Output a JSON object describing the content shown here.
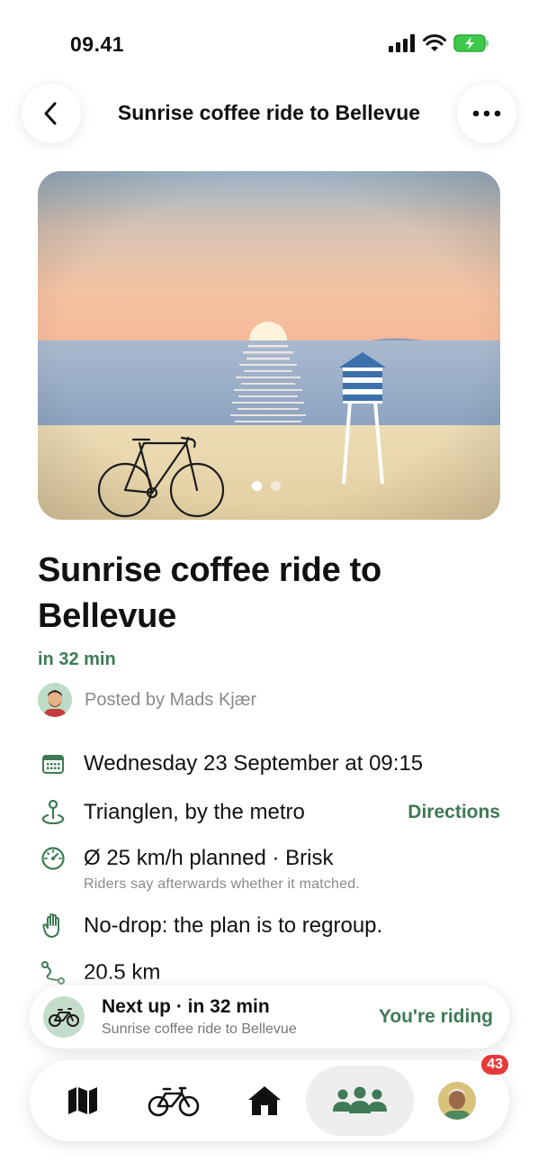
{
  "status_bar": {
    "time": "09.41"
  },
  "header": {
    "title": "Sunrise coffee ride to Bellevue"
  },
  "ride": {
    "title": "Sunrise coffee ride to Bellevue",
    "starts_in": "in 32 min",
    "posted_by": "Posted by Mads Kjær",
    "carousel": {
      "pages": 2,
      "current": 1
    },
    "details": [
      {
        "icon": "calendar-icon",
        "text": "Wednesday 23 September at 09:15"
      },
      {
        "icon": "meeting-point-icon",
        "text": "Trianglen, by the metro",
        "action": "Directions"
      },
      {
        "icon": "speedometer-icon",
        "text": "Ø 25 km/h planned · Brisk",
        "sub": "Riders say afterwards whether it matched."
      },
      {
        "icon": "hand-icon",
        "text": "No-drop: the plan is to regroup."
      },
      {
        "icon": "route-icon",
        "text": "20.5 km"
      }
    ]
  },
  "next_up": {
    "title": "Next up · in 32 min",
    "subtitle": "Sunrise coffee ride to Bellevue",
    "action": "You're riding"
  },
  "tab_bar": {
    "tabs": [
      {
        "icon": "map-icon"
      },
      {
        "icon": "bicycle-icon"
      },
      {
        "icon": "home-icon"
      },
      {
        "icon": "group-icon",
        "active": true
      },
      {
        "icon": "profile-avatar",
        "badge": "43"
      }
    ]
  },
  "colors": {
    "accent": "#3d7a55",
    "badge": "#e63b3b"
  }
}
